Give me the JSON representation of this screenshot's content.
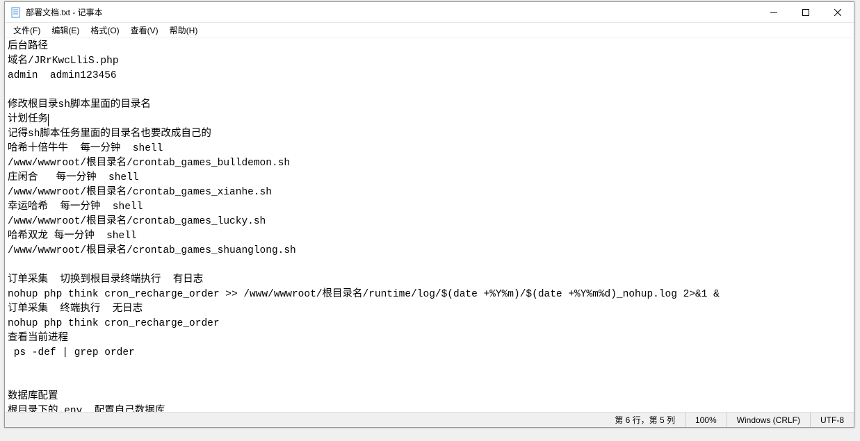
{
  "window": {
    "title": "部署文档.txt - 记事本"
  },
  "menu": {
    "file": "文件(F)",
    "edit": "编辑(E)",
    "format": "格式(O)",
    "view": "查看(V)",
    "help": "帮助(H)"
  },
  "content": {
    "line1": "后台路径",
    "line2": "域名/JRrKwcLliS.php",
    "line3": "admin  admin123456",
    "line4": "",
    "line5": "修改根目录sh脚本里面的目录名",
    "line6": "计划任务",
    "line7": "记得sh脚本任务里面的目录名也要改成自己的",
    "line8": "哈希十倍牛牛  每一分钟  shell",
    "line9": "/www/wwwroot/根目录名/crontab_games_bulldemon.sh",
    "line10": "庄闲合   每一分钟  shell",
    "line11": "/www/wwwroot/根目录名/crontab_games_xianhe.sh",
    "line12": "幸运哈希  每一分钟  shell",
    "line13": "/www/wwwroot/根目录名/crontab_games_lucky.sh",
    "line14": "哈希双龙 每一分钟  shell",
    "line15": "/www/wwwroot/根目录名/crontab_games_shuanglong.sh",
    "line16": "",
    "line17": "订单采集  切换到根目录终端执行  有日志",
    "line18": "nohup php think cron_recharge_order >> /www/wwwroot/根目录名/runtime/log/$(date +%Y%m)/$(date +%Y%m%d)_nohup.log 2>&1 &",
    "line19": "订单采集  终端执行  无日志",
    "line20": "nohup php think cron_recharge_order",
    "line21": "查看当前进程",
    "line22": " ps -def | grep order",
    "line23": "",
    "line24": "",
    "line25": "数据库配置",
    "line26": "根目录下的.env  配置自己数据库"
  },
  "status": {
    "position": "第 6 行，第 5 列",
    "zoom": "100%",
    "lineending": "Windows (CRLF)",
    "encoding": "UTF-8"
  }
}
